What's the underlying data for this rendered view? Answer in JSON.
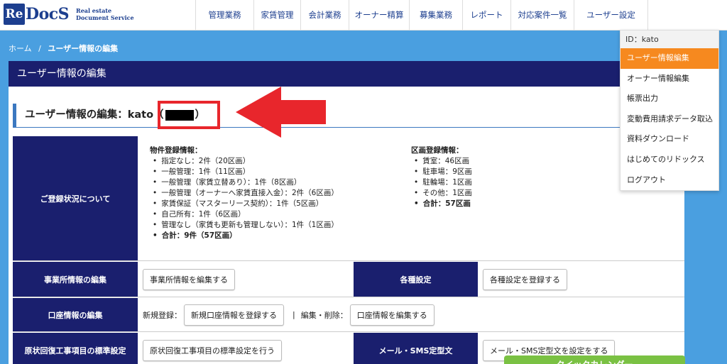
{
  "logo": {
    "mark": "Re",
    "name": "DocS",
    "sub_line1": "Real estate",
    "sub_line2": "Document Service"
  },
  "nav": [
    {
      "label": "管理業務",
      "width": 82
    },
    {
      "label": "家賃管理",
      "width": 66
    },
    {
      "label": "会計業務",
      "width": 68
    },
    {
      "label": "オーナー精算",
      "width": 85
    },
    {
      "label": "募集業務",
      "width": 75
    },
    {
      "label": "レポート",
      "width": 68
    },
    {
      "label": "対応案件一覧",
      "width": 89
    },
    {
      "label": "ユーザー設定",
      "width": 105
    }
  ],
  "breadcrumb": {
    "home": "ホーム",
    "separator": "/",
    "current": "ユーザー情報の編集"
  },
  "panel": {
    "title": "ユーザー情報の編集"
  },
  "section": {
    "title_prefix": "ユーザー情報の編集：kato（",
    "title_suffix": "）"
  },
  "registration": {
    "header": "ご登録状況について",
    "property": {
      "title": "物件登録情報：",
      "items": [
        "指定なし：2件（20区画）",
        "一般管理：1件（11区画）",
        "一般管理（家賃立替あり）：1件（8区画）",
        "一般管理（オーナーへ家賃直接入金）：2件（6区画）",
        "家賃保証（マスターリース契約）：1件（5区画）",
        "自己所有：1件（6区画）",
        "管理なし（家賃も更新も管理しない）：1件（1区画）"
      ],
      "total": "合計：9件（57区画）"
    },
    "units": {
      "title": "区画登録情報：",
      "items": [
        "賃室：46区画",
        "駐車場：9区画",
        "駐輪場：1区画",
        "その他：1区画"
      ],
      "total": "合計：57区画"
    }
  },
  "rows": {
    "office": {
      "header": "事業所情報の編集",
      "button": "事業所情報を編集する"
    },
    "settings": {
      "header": "各種設定",
      "button": "各種設定を登録する"
    },
    "account": {
      "header": "口座情報の編集",
      "new_label": "新規登録：",
      "new_button": "新規口座情報を登録する",
      "divider": "|",
      "edit_label": "編集・削除：",
      "edit_button": "口座情報を編集する"
    },
    "restore": {
      "header": "原状回復工事項目の標準設定",
      "button": "原状回復工事項目の標準設定を行う"
    },
    "mail": {
      "header": "メール・SMS定型文",
      "button": "メール・SMS定型文を設定をする"
    }
  },
  "dropdown": {
    "id": "ID：kato",
    "items": [
      {
        "label": "ユーザー情報編集",
        "active": true
      },
      {
        "label": "オーナー情報編集",
        "active": false
      },
      {
        "label": "帳票出力",
        "active": false
      },
      {
        "label": "変動費用請求データ取込",
        "active": false
      },
      {
        "label": "資料ダウンロード",
        "active": false
      },
      {
        "label": "はじめてのリドックス",
        "active": false
      },
      {
        "label": "ログアウト",
        "active": false
      }
    ]
  },
  "green_button": "クイックカレンダー",
  "colors": {
    "navy": "#1a1f6e",
    "accent_orange": "#f6891f",
    "annotation_red": "#e8262c",
    "background_blue": "#4a9fe0"
  }
}
